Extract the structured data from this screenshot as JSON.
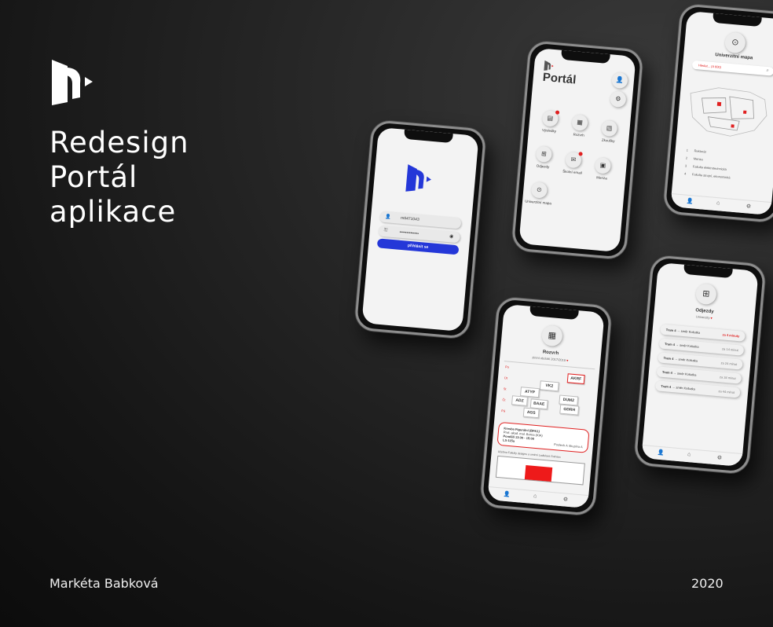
{
  "colors": {
    "accent": "#2437d8",
    "alert": "#e02020",
    "background": "#1a1a1a"
  },
  "brand": {
    "logo_icon": "portal-logo"
  },
  "title_lines": [
    "Redesign",
    "Portál",
    "aplikace"
  ],
  "author": "Markéta Babková",
  "year": "2020",
  "login": {
    "username": "m6471043",
    "password": "••••••••••••••",
    "button": "přihlásit se",
    "icons": [
      "user-icon",
      "key-icon",
      "eye-icon"
    ]
  },
  "portal": {
    "title": "Portál",
    "tiles": [
      {
        "label": "Výsledky",
        "icon": "document-icon",
        "badge": true
      },
      {
        "label": "Rozvrh",
        "icon": "calendar-icon",
        "badge": false
      },
      {
        "label": "Zkoušky",
        "icon": "clipboard-icon",
        "badge": false
      },
      {
        "label": "Odjezdy",
        "icon": "tram-icon",
        "badge": false
      },
      {
        "label": "Školní email",
        "icon": "mail-icon",
        "badge": true
      },
      {
        "label": "Menza",
        "icon": "menu-icon",
        "badge": false
      },
      {
        "label": "Univerzitní mapa",
        "icon": "location-icon",
        "badge": false
      }
    ]
  },
  "map": {
    "title": "Univerzitní mapa",
    "search": "Hledat... (A 600)",
    "legend": [
      {
        "num": "1",
        "label": "Rektorát"
      },
      {
        "num": "2",
        "label": "Menza"
      },
      {
        "num": "3",
        "label": "Fakulta elektrotechnická"
      },
      {
        "num": "4",
        "label": "Fakulta strojní, ekonomická"
      }
    ]
  },
  "schedule": {
    "title": "Rozvrh",
    "subtitle": "zimní období 2017/2018",
    "days": [
      "Po",
      "Út",
      "St",
      "Čt",
      "Pá"
    ],
    "blocks": [
      "AKRF",
      "VK2",
      "ATYP",
      "DUM2",
      "ADZ",
      "BAAE",
      "GDRH",
      "AGS"
    ],
    "card": {
      "title": "Kresba Figurální (BFK1)",
      "teacher": "Prof. akad. mal. Borna (KIA)",
      "time": "Pondělí 13:30 - 15:00",
      "room": "LS-115a",
      "meta": "Poslech A\nSkupina A"
    },
    "note": "Učebna Fakulty designu a umění Ladislava Sutnara"
  },
  "departures": {
    "title": "Odjezdy",
    "subtitle": "Univerzity",
    "rows": [
      {
        "line": "Tram 4",
        "dest": "směr Košutka",
        "time": "za 4 minuty",
        "hot": true
      },
      {
        "line": "Tram 4",
        "dest": "směr Košutka",
        "time": "za 14 minut",
        "hot": false
      },
      {
        "line": "Tram 4",
        "dest": "směr Košutka",
        "time": "za 24 minut",
        "hot": false
      },
      {
        "line": "Tram 4",
        "dest": "směr Košutka",
        "time": "za 34 minut",
        "hot": false
      },
      {
        "line": "Tram 4",
        "dest": "směr Košutka",
        "time": "za 44 minut",
        "hot": false
      }
    ]
  }
}
